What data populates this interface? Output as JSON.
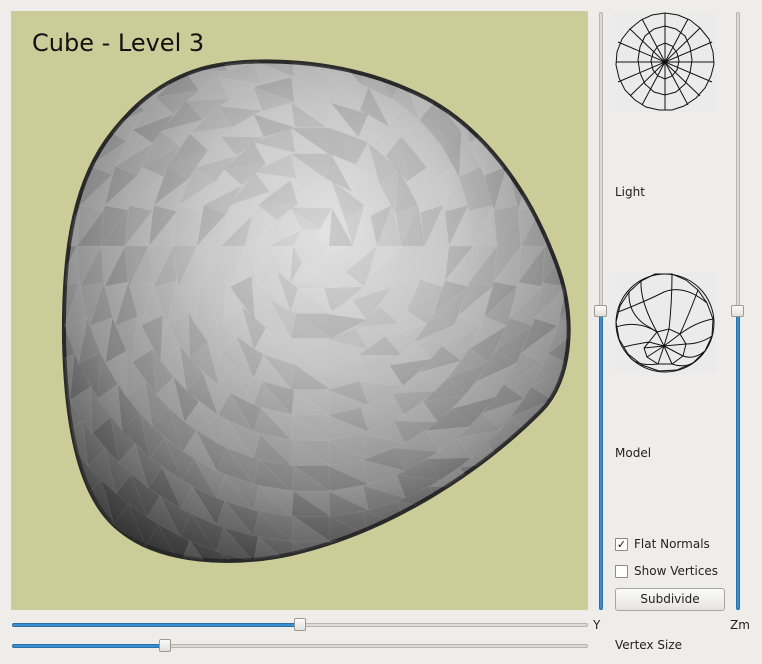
{
  "viewport": {
    "title": "Cube - Level 3",
    "background": "#cccc99"
  },
  "light_panel": {
    "label": "Light"
  },
  "model_panel": {
    "label": "Model"
  },
  "options": {
    "flat_normals": {
      "label": "Flat Normals",
      "checked": true,
      "mark": "✓"
    },
    "show_vertices": {
      "label": "Show Vertices",
      "checked": false,
      "mark": ""
    }
  },
  "subdivide_button": {
    "label": "Subdivide"
  },
  "sliders": {
    "y": {
      "label": "Y",
      "value": 0.5
    },
    "vertex_size": {
      "label": "Vertex Size",
      "value": 0.26
    },
    "rotation_vertical": {
      "value": 0.5
    },
    "zoom": {
      "label": "Zm",
      "value": 0.5
    }
  },
  "colors": {
    "accent": "#3a8fd0",
    "window_bg": "#efedea"
  }
}
